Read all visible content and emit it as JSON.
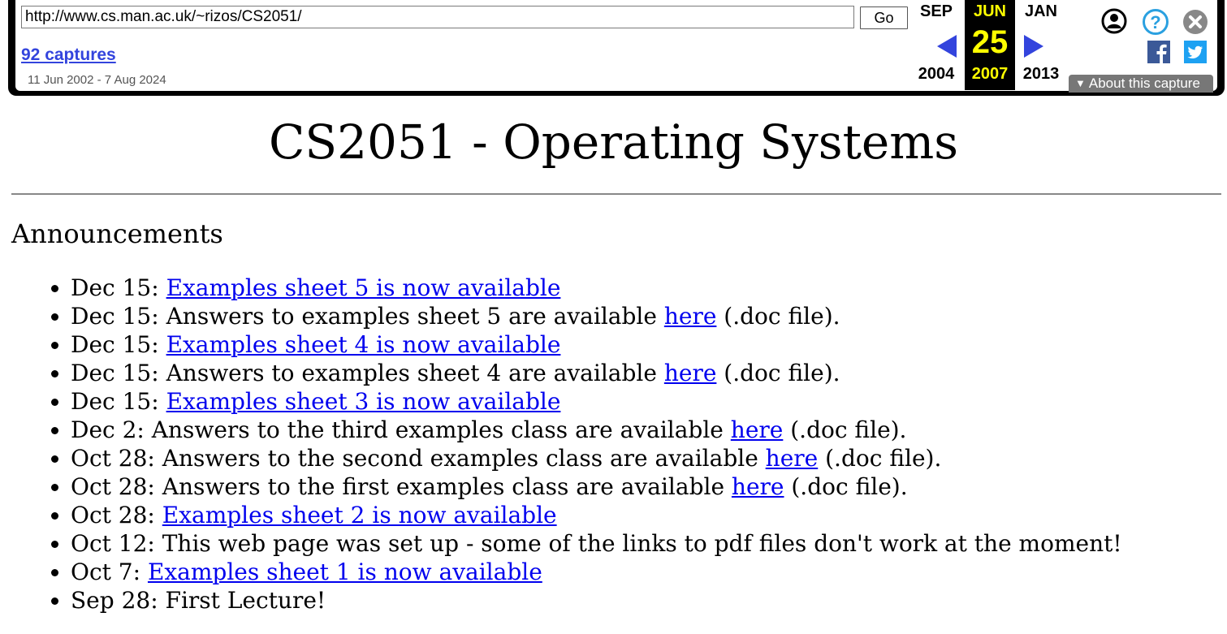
{
  "toolbar": {
    "url_value": "http://www.cs.man.ac.uk/~rizos/CS2051/",
    "go_label": "Go",
    "captures_label": "92 captures",
    "date_range": "11 Jun 2002 - 7 Aug 2024",
    "prev": {
      "month": "SEP",
      "year": "2004"
    },
    "current": {
      "month": "JUN",
      "day": "25",
      "year": "2007"
    },
    "next": {
      "month": "JAN",
      "year": "2013"
    },
    "about_label": "About this capture",
    "colors": {
      "current_highlight": "#ffff00",
      "arrow": "#3344dd",
      "facebook": "#3b5998",
      "twitter": "#1da1f2",
      "help": "#2aa0e0"
    }
  },
  "page": {
    "title": "CS2051 - Operating Systems",
    "announcements_heading": "Announcements",
    "items": [
      {
        "prefix": "Dec 15: ",
        "link": "Examples sheet 5 is now available",
        "suffix": ""
      },
      {
        "prefix": "Dec 15: Answers to examples sheet 5 are available ",
        "link": "here",
        "suffix": " (.doc file)."
      },
      {
        "prefix": "Dec 15: ",
        "link": "Examples sheet 4 is now available",
        "suffix": ""
      },
      {
        "prefix": "Dec 15: Answers to examples sheet 4 are available ",
        "link": "here",
        "suffix": " (.doc file)."
      },
      {
        "prefix": "Dec 15: ",
        "link": "Examples sheet 3 is now available",
        "suffix": ""
      },
      {
        "prefix": "Dec 2: Answers to the third examples class are available ",
        "link": "here",
        "suffix": " (.doc file)."
      },
      {
        "prefix": "Oct 28: Answers to the second examples class are available ",
        "link": "here",
        "suffix": " (.doc file)."
      },
      {
        "prefix": "Oct 28: Answers to the first examples class are available ",
        "link": "here",
        "suffix": " (.doc file)."
      },
      {
        "prefix": "Oct 28: ",
        "link": "Examples sheet 2 is now available",
        "suffix": ""
      },
      {
        "prefix": "Oct 12: This web page was set up - some of the links to pdf files don't work at the moment!",
        "link": "",
        "suffix": ""
      },
      {
        "prefix": "Oct 7: ",
        "link": "Examples sheet 1 is now available",
        "suffix": ""
      },
      {
        "prefix": "Sep 28: First Lecture!",
        "link": "",
        "suffix": ""
      }
    ]
  }
}
